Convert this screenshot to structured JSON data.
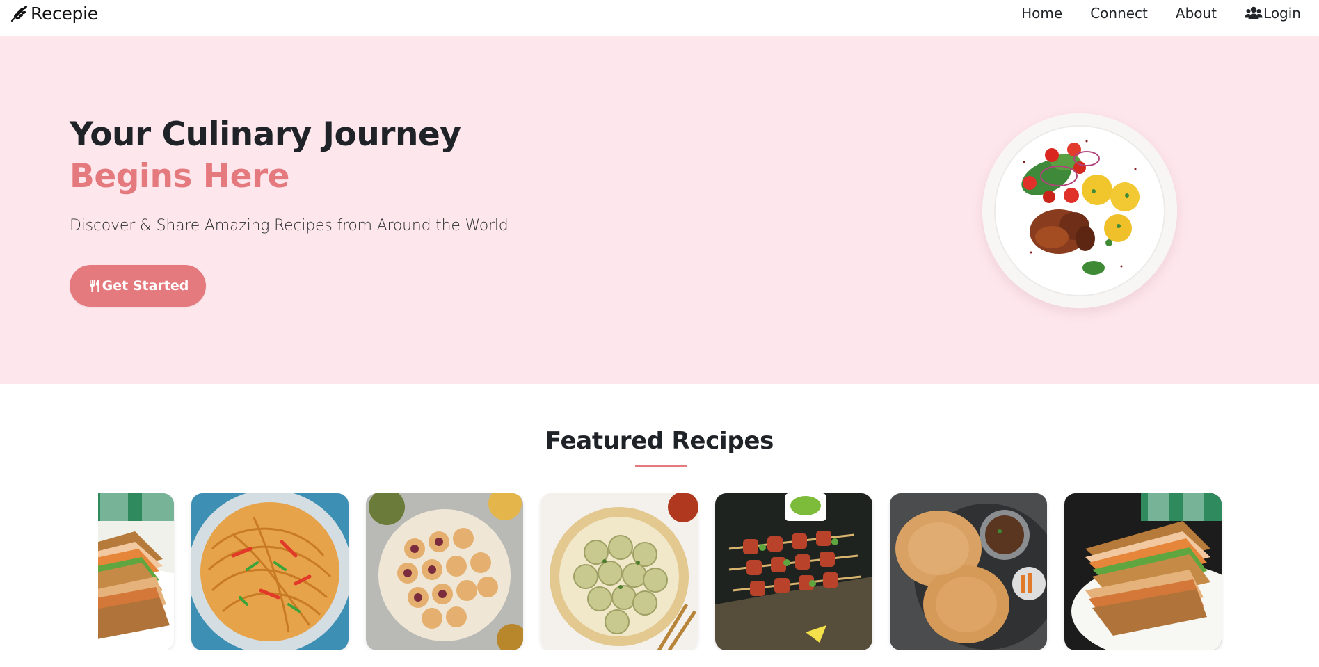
{
  "navbar": {
    "brand": {
      "icon": "leaf-icon",
      "label": "Recepie"
    },
    "links": [
      {
        "label": "Home"
      },
      {
        "label": "Connect"
      },
      {
        "label": "About"
      },
      {
        "label": "Login",
        "icon": "users-icon"
      }
    ]
  },
  "hero": {
    "title_line1": "Your Culinary Journey",
    "title_line2": "Begins Here",
    "subtitle": "Discover & Share Amazing Recipes from Around the World",
    "cta": {
      "label": "Get Started",
      "icon": "utensils-icon"
    },
    "image": "food-plate-image"
  },
  "featured": {
    "title": "Featured Recipes",
    "cards": [
      {
        "image": "sandwich-image"
      },
      {
        "image": "noodles-image"
      },
      {
        "image": "pani-puri-image"
      },
      {
        "image": "momos-image"
      },
      {
        "image": "kebab-skewers-image"
      },
      {
        "image": "puri-curry-image"
      },
      {
        "image": "sandwich-image"
      }
    ]
  },
  "colors": {
    "accent": "#e47a7d",
    "hero_bg": "#fde6ec",
    "text": "#1f2328"
  }
}
